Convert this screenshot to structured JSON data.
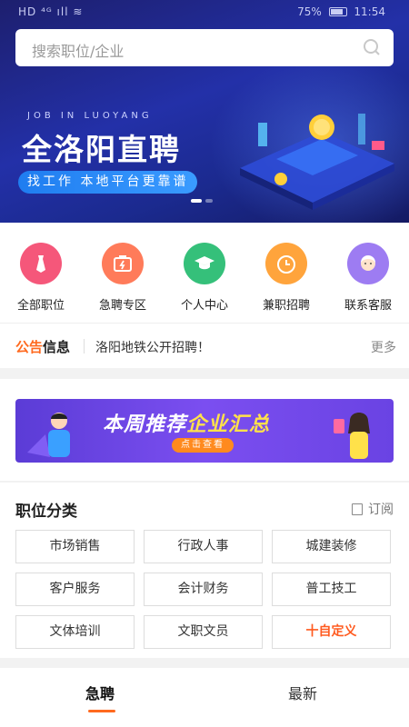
{
  "status_bar": {
    "left": "HD ⁴ᴳ ıll ≋",
    "battery_percent": "75%",
    "time": "11:54"
  },
  "search": {
    "placeholder": "搜索职位/企业"
  },
  "hero": {
    "english_tag": "JOB IN LUOYANG",
    "title": "全洛阳直聘",
    "tagline": "找工作 本地平台更靠谱",
    "colors": {
      "bg": "#2330a8",
      "tag": "#2a8af5"
    }
  },
  "quick_menu": [
    {
      "label": "全部职位",
      "icon": "tie-icon",
      "color": "#f5577a"
    },
    {
      "label": "急聘专区",
      "icon": "urgent-bag-icon",
      "color": "#ff7b5a"
    },
    {
      "label": "个人中心",
      "icon": "graduation-cap-icon",
      "color": "#35c07a"
    },
    {
      "label": "兼职招聘",
      "icon": "clock-icon",
      "color": "#ffa43c"
    },
    {
      "label": "联系客服",
      "icon": "service-avatar-icon",
      "color": "#9d7cf2"
    }
  ],
  "notice": {
    "brand_part1": "公告",
    "brand_part2": "信息",
    "text": "洛阳地铁公开招聘！",
    "more": "更多"
  },
  "promo": {
    "title_part1": "本周推荐",
    "title_part2": "企业汇总",
    "button": "点击查看"
  },
  "categories": {
    "title": "职位分类",
    "subscribe": "订阅",
    "items": [
      "市场销售",
      "行政人事",
      "城建装修",
      "客户服务",
      "会计财务",
      "普工技工",
      "文体培训",
      "文职文员",
      "十自定义"
    ]
  },
  "tabs": {
    "active": "急聘",
    "other": "最新",
    "accent": "#ff6a1f"
  }
}
